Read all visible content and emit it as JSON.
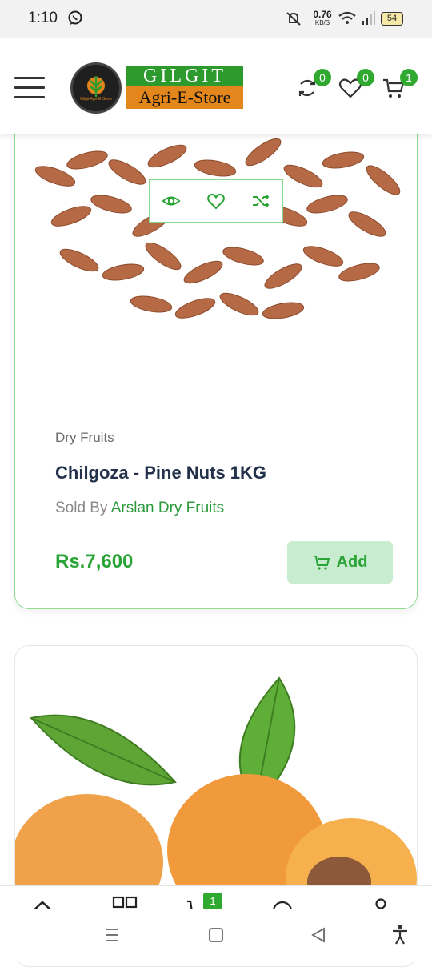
{
  "status_bar": {
    "time": "1:10",
    "net_speed": "0.76",
    "net_unit": "KB/S",
    "battery": "54"
  },
  "header": {
    "logo_title": "GILGIT",
    "logo_subtitle": "Agri-E-Store",
    "logo_circle_text": "Gilgit Agri-E-Store",
    "compare_count": "0",
    "wishlist_count": "0",
    "cart_count": "1"
  },
  "product": {
    "category": "Dry Fruits",
    "name": "Chilgoza - Pine Nuts 1KG",
    "sold_by_label": "Sold By",
    "vendor": "Arslan Dry Fruits",
    "price": "Rs.7,600",
    "add_label": "Add"
  },
  "bottom_nav": {
    "cart_count": "1"
  },
  "colors": {
    "brand_green": "#2aa436",
    "brand_orange": "#e3861b",
    "badge_green": "#2fa92f"
  },
  "icons": [
    "whatsapp-icon",
    "mute-icon",
    "wifi-icon",
    "signal-icon",
    "battery-icon",
    "menu-icon",
    "compare-icon",
    "heart-icon",
    "cart-icon",
    "eye-icon",
    "shuffle-icon",
    "chevron-up-icon",
    "grid-icon",
    "user-icon",
    "accessibility-icon"
  ]
}
